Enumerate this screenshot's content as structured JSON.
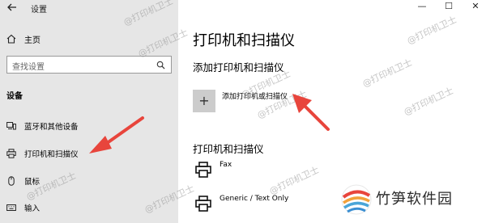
{
  "window": {
    "title": "设置",
    "minimize": "—",
    "maximize": "☐",
    "close": "✕"
  },
  "sidebar": {
    "back_icon": "back-arrow-icon",
    "home_label": "主页",
    "search_placeholder": "查找设置",
    "section": "设备",
    "items": [
      {
        "label": "蓝牙和其他设备",
        "icon": "bluetooth-devices-icon"
      },
      {
        "label": "打印机和扫描仪",
        "icon": "printer-icon"
      },
      {
        "label": "鼠标",
        "icon": "mouse-icon"
      },
      {
        "label": "输入",
        "icon": "keyboard-icon"
      }
    ]
  },
  "main": {
    "title": "打印机和扫描仪",
    "add_heading": "添加打印机和扫描仪",
    "add_label": "添加打印机或扫描仪",
    "add_icon": "plus-icon",
    "list_heading": "打印机和扫描仪",
    "printers": [
      {
        "label": "Fax",
        "icon": "printer-icon"
      },
      {
        "label": "Generic / Text Only",
        "icon": "printer-icon"
      }
    ]
  },
  "watermark": "@打印机卫士",
  "logo": {
    "text": "竹笋软件园",
    "accent": "#e8453c"
  },
  "colors": {
    "sidebar_bg": "#e6e6e6",
    "tile_bg": "#cccccc",
    "arrow": "#e8453c"
  }
}
